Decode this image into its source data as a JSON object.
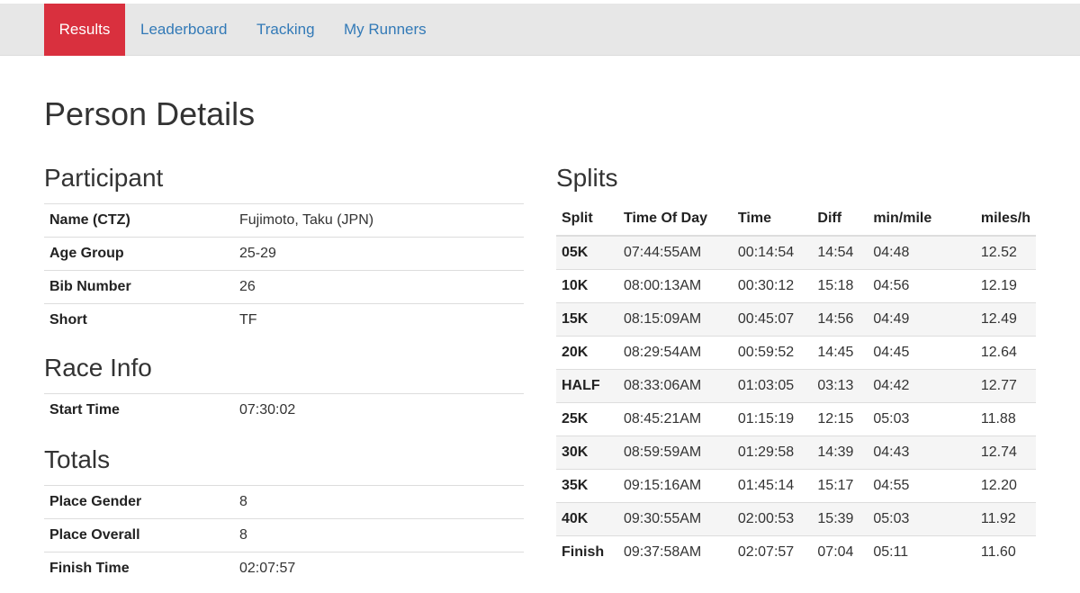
{
  "nav": {
    "results": "Results",
    "leaderboard": "Leaderboard",
    "tracking": "Tracking",
    "my_runners": "My Runners"
  },
  "page_title": "Person Details",
  "participant": {
    "title": "Participant",
    "rows": [
      {
        "label": "Name (CTZ)",
        "value": "Fujimoto, Taku (JPN)"
      },
      {
        "label": "Age Group",
        "value": "25-29"
      },
      {
        "label": "Bib Number",
        "value": "26"
      },
      {
        "label": "Short",
        "value": "TF"
      }
    ]
  },
  "race_info": {
    "title": "Race Info",
    "rows": [
      {
        "label": "Start Time",
        "value": "07:30:02"
      }
    ]
  },
  "totals": {
    "title": "Totals",
    "rows": [
      {
        "label": "Place Gender",
        "value": "8"
      },
      {
        "label": "Place Overall",
        "value": "8"
      },
      {
        "label": "Finish Time",
        "value": "02:07:57"
      }
    ]
  },
  "splits": {
    "title": "Splits",
    "headers": [
      "Split",
      "Time Of Day",
      "Time",
      "Diff",
      "min/mile",
      "miles/h"
    ],
    "rows": [
      [
        "05K",
        "07:44:55AM",
        "00:14:54",
        "14:54",
        "04:48",
        "12.52"
      ],
      [
        "10K",
        "08:00:13AM",
        "00:30:12",
        "15:18",
        "04:56",
        "12.19"
      ],
      [
        "15K",
        "08:15:09AM",
        "00:45:07",
        "14:56",
        "04:49",
        "12.49"
      ],
      [
        "20K",
        "08:29:54AM",
        "00:59:52",
        "14:45",
        "04:45",
        "12.64"
      ],
      [
        "HALF",
        "08:33:06AM",
        "01:03:05",
        "03:13",
        "04:42",
        "12.77"
      ],
      [
        "25K",
        "08:45:21AM",
        "01:15:19",
        "12:15",
        "05:03",
        "11.88"
      ],
      [
        "30K",
        "08:59:59AM",
        "01:29:58",
        "14:39",
        "04:43",
        "12.74"
      ],
      [
        "35K",
        "09:15:16AM",
        "01:45:14",
        "15:17",
        "04:55",
        "12.20"
      ],
      [
        "40K",
        "09:30:55AM",
        "02:00:53",
        "15:39",
        "05:03",
        "11.92"
      ],
      [
        "Finish",
        "09:37:58AM",
        "02:07:57",
        "07:04",
        "05:11",
        "11.60"
      ]
    ]
  },
  "colors": {
    "active_tab": "#d9303e",
    "link": "#337ab7",
    "navbar": "#e7e7e7",
    "stripe": "#f5f5f5"
  }
}
